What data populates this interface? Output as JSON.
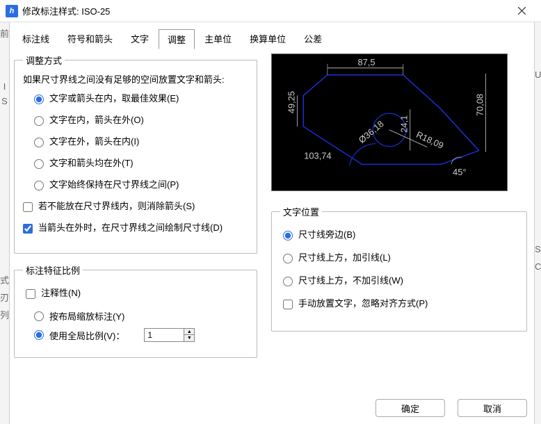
{
  "titlebar": {
    "app_icon": "h",
    "title": "修改标注样式: ISO-25"
  },
  "tabs": {
    "items": [
      {
        "label": "标注线"
      },
      {
        "label": "符号和箭头"
      },
      {
        "label": "文字"
      },
      {
        "label": "调整"
      },
      {
        "label": "主单位"
      },
      {
        "label": "换算单位"
      },
      {
        "label": "公差"
      }
    ],
    "active_index": 3
  },
  "fit": {
    "legend": "调整方式",
    "intro": "如果尺寸界线之间没有足够的空间放置文字和箭头:",
    "options": [
      "文字或箭头在内，取最佳效果(E)",
      "文字在内，箭头在外(O)",
      "文字在外，箭头在内(I)",
      "文字和箭头均在外(T)",
      "文字始终保持在尺寸界线之间(P)"
    ],
    "selected_index": 0,
    "suppress": {
      "label": "若不能放在尺寸界线内，则消除箭头(S)",
      "checked": false
    },
    "draw_dim": {
      "label": "当箭头在外时，在尺寸界线之间绘制尺寸线(D)",
      "checked": true
    }
  },
  "scale": {
    "legend": "标注特征比例",
    "annotative": {
      "label": "注释性(N)",
      "checked": false
    },
    "options": [
      "按布局缩放标注(Y)",
      "使用全局比例(V)："
    ],
    "selected_index": 1,
    "global_value": "1"
  },
  "text_pos": {
    "legend": "文字位置",
    "options": [
      "尺寸线旁边(B)",
      "尺寸线上方，加引线(L)",
      "尺寸线上方，不加引线(W)"
    ],
    "selected_index": 0,
    "manual": {
      "label": "手动放置文字，忽略对齐方式(P)",
      "checked": false
    }
  },
  "preview": {
    "dim_top": "87,5",
    "dim_left": "49,25",
    "dim_inner": "24,1",
    "dim_right": "70,08",
    "dim_bottom": "103,74",
    "dim_diag": "R18,09",
    "dim_diam": "Ø36,18",
    "dim_angle": "45°"
  },
  "buttons": {
    "ok": "确定",
    "cancel": "取消"
  },
  "edges": {
    "left": [
      "前",
      "I",
      "S",
      "式",
      "刃",
      "列"
    ],
    "right": [
      "U",
      "S",
      "C"
    ]
  }
}
